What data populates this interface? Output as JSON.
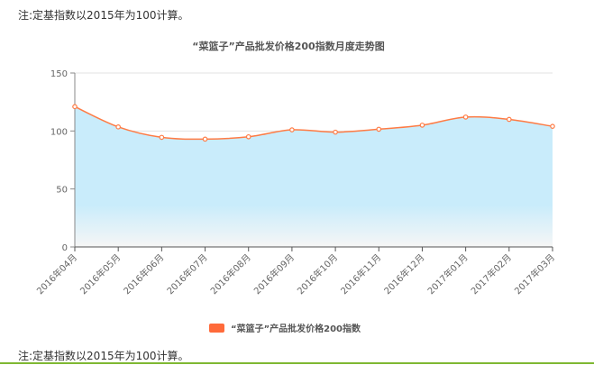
{
  "notes": {
    "top": "注:定基指数以2015年为100计算。",
    "bottom": "注:定基指数以2015年为100计算。"
  },
  "colors": {
    "line": "#ff7b44",
    "area_top": "#c9ecfb",
    "area_bottom": "#f6f6f6",
    "legend": "#ff6a3a",
    "accent_line": "#7fb832"
  },
  "chart_data": {
    "type": "area",
    "title": "“菜篮子”产品批发价格200指数月度走势图",
    "categories": [
      "2016年04月",
      "2016年05月",
      "2016年06月",
      "2016年07月",
      "2016年08月",
      "2016年09月",
      "2016年10月",
      "2016年11月",
      "2016年12月",
      "2017年01月",
      "2017年02月",
      "2017年03月"
    ],
    "series": [
      {
        "name": "“菜篮子”产品批发价格200指数",
        "values": [
          121,
          103.5,
          94.5,
          93,
          95,
          101,
          99,
          101.5,
          105,
          112,
          110,
          104
        ]
      }
    ],
    "ylim": [
      0,
      150
    ],
    "yticks": [
      0,
      50,
      100,
      150
    ],
    "grid": true,
    "legend": "bottom-center"
  }
}
